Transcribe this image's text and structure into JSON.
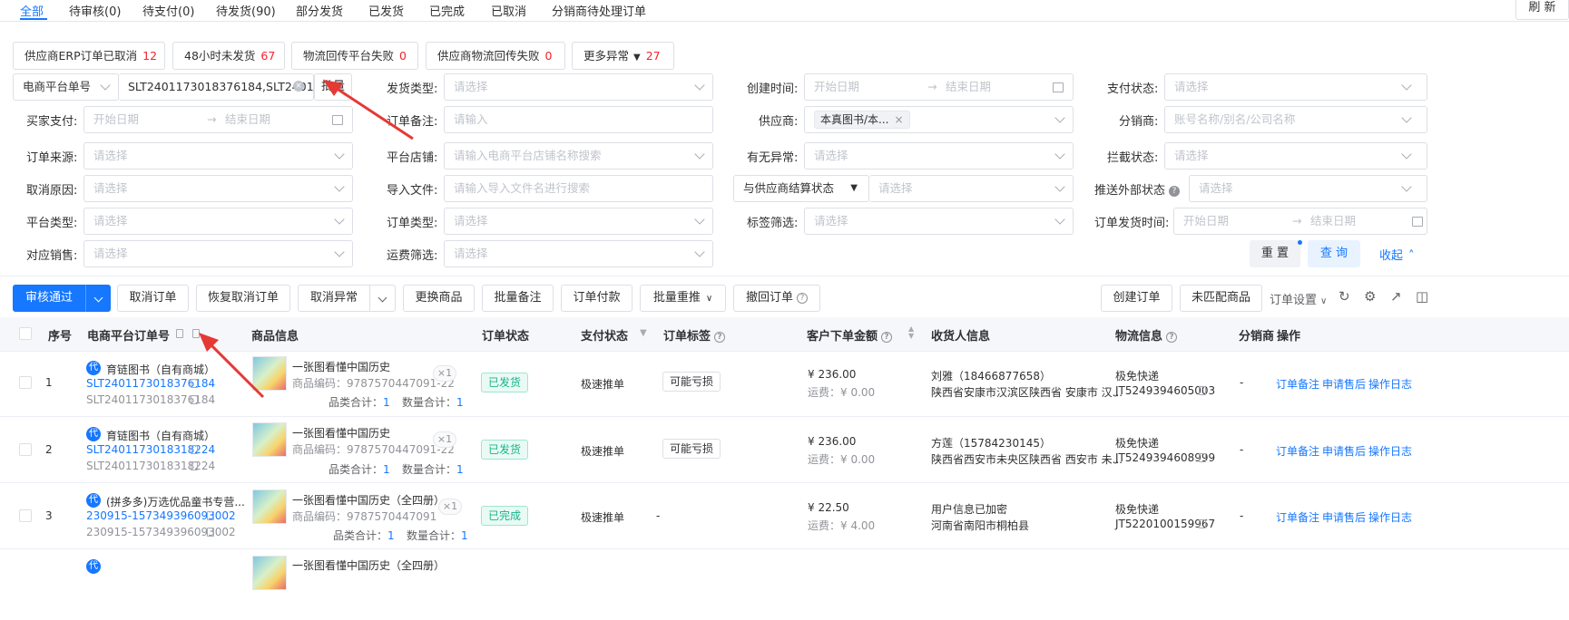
{
  "tabs": [
    "全部",
    "待审核(0)",
    "待支付(0)",
    "待发货(90)",
    "部分发货",
    "已发货",
    "已完成",
    "已取消",
    "分销商待处理订单"
  ],
  "refresh": "刷 新",
  "chips": [
    {
      "label": "供应商ERP订单已取消",
      "count": "12"
    },
    {
      "label": "48小时未发货",
      "count": "67"
    },
    {
      "label": "物流回传平台失败",
      "count": "0"
    },
    {
      "label": "供应商物流回传失败",
      "count": "0"
    },
    {
      "label": "更多异常",
      "count": "27"
    }
  ],
  "filters": {
    "order_no_type": "电商平台单号",
    "order_no_value": "SLT2401173018376184,SLT2401",
    "batch": "批量",
    "ship_type_label": "发货类型:",
    "ship_type_ph": "请选择",
    "created_label": "创建时间:",
    "start_ph": "开始日期",
    "end_ph": "结束日期",
    "pay_status_label": "支付状态:",
    "pay_status_ph": "请选择",
    "buyer_pay_label": "买家支付:",
    "order_remark_label": "订单备注:",
    "order_remark_ph": "请输入",
    "supplier_label": "供应商:",
    "supplier_value": "本真图书/本...",
    "distributor_label": "分销商:",
    "distributor_ph": "账号名称/别名/公司名称",
    "source_label": "订单来源:",
    "source_ph": "请选择",
    "shop_label": "平台店铺:",
    "shop_ph": "请输入电商平台店铺名称搜索",
    "exception_label": "有无异常:",
    "exception_ph": "请选择",
    "intercept_label": "拦截状态:",
    "intercept_ph": "请选择",
    "cancel_label": "取消原因:",
    "cancel_ph": "请选择",
    "import_label": "导入文件:",
    "import_ph": "请输入导入文件名进行搜索",
    "settle_label": "与供应商结算状态",
    "settle_ph": "请选择",
    "push_label": "推送外部状态",
    "push_ph": "请选择",
    "platform_type_label": "平台类型:",
    "platform_type_ph": "请选择",
    "order_type_label": "订单类型:",
    "order_type_ph": "请选择",
    "tag_label": "标签筛选:",
    "tag_ph": "请选择",
    "ship_time_label": "订单发货时间:",
    "sales_label": "对应销售:",
    "sales_ph": "请选择",
    "freight_label": "运费筛选:",
    "freight_ph": "请选择",
    "reset": "重 置",
    "query": "查 询",
    "collapse": "收起"
  },
  "toolbar": {
    "approve": "审核通过",
    "cancel_order": "取消订单",
    "restore_cancel": "恢复取消订单",
    "cancel_exception": "取消异常",
    "replace_goods": "更换商品",
    "batch_remark": "批量备注",
    "order_pay": "订单付款",
    "batch_repush": "批量重推",
    "revoke_order": "撤回订单",
    "create_order": "创建订单",
    "unmatched_goods": "未匹配商品",
    "order_settings": "订单设置"
  },
  "columns": {
    "seq": "序号",
    "order_no": "电商平台订单号",
    "goods": "商品信息",
    "order_status": "订单状态",
    "pay_status": "支付状态",
    "order_tag": "订单标签",
    "amount": "客户下单金额",
    "receiver": "收货人信息",
    "logistics": "物流信息",
    "distributor": "分销商",
    "actions": "操作"
  },
  "rows": [
    {
      "seq": "1",
      "shop": "育链图书（自有商城）",
      "order_no": "SLT2401173018376184",
      "sub_no": "SLT2401173018376184",
      "goods_title": "一张图看懂中国历史",
      "goods_code": "商品编码：9787570447091-22",
      "qty_badge": "×1",
      "cat_total_label": "品类合计：",
      "cat_total": "1",
      "qty_total_label": "数量合计：",
      "qty_total": "1",
      "status": "已发货",
      "pay": "极速推单",
      "tag": "可能亏损",
      "amount": "¥ 236.00",
      "freight": "运费：¥ 0.00",
      "receiver": "刘雅（18466877658）",
      "address": "陕西省安康市汉滨区陕西省 安康市 汉...",
      "carrier": "极免快递",
      "tracking": "JT5249394605003",
      "distributor": "-",
      "act1": "订单备注",
      "act2": "申请售后",
      "act3": "操作日志"
    },
    {
      "seq": "2",
      "shop": "育链图书（自有商城）",
      "order_no": "SLT2401173018318224",
      "sub_no": "SLT2401173018318224",
      "goods_title": "一张图看懂中国历史",
      "goods_code": "商品编码：9787570447091-22",
      "qty_badge": "×1",
      "cat_total_label": "品类合计：",
      "cat_total": "1",
      "qty_total_label": "数量合计：",
      "qty_total": "1",
      "status": "已发货",
      "pay": "极速推单",
      "tag": "可能亏损",
      "amount": "¥ 236.00",
      "freight": "运费：¥ 0.00",
      "receiver": "方莲（15784230145）",
      "address": "陕西省西安市未央区陕西省 西安市 未...",
      "carrier": "极免快递",
      "tracking": "JT5249394608999",
      "distributor": "-",
      "act1": "订单备注",
      "act2": "申请售后",
      "act3": "操作日志"
    },
    {
      "seq": "3",
      "shop": "(拼多多)万选优品童书专营...",
      "order_no": "230915-157349396093002",
      "sub_no": "230915-157349396093002",
      "goods_title": "一张图看懂中国历史（全四册）",
      "goods_code": "商品编码：9787570447091",
      "qty_badge": "×1",
      "cat_total_label": "品类合计：",
      "cat_total": "1",
      "qty_total_label": "数量合计：",
      "qty_total": "1",
      "status": "已完成",
      "pay": "极速推单",
      "tag": "-",
      "amount": "¥ 22.50",
      "freight": "运费：¥ 4.00",
      "receiver": "用户信息已加密",
      "address": "河南省南阳市桐柏县",
      "carrier": "极免快递",
      "tracking": "JT5220100159967",
      "distributor": "-",
      "act1": "订单备注",
      "act2": "申请售后",
      "act3": "操作日志"
    }
  ],
  "row4_goods_title": "一张图看懂中国历史（全四册）",
  "dai": "代",
  "colors": {
    "primary": "#1677ff",
    "danger": "#f5222d",
    "success": "#17b589",
    "annotation": "#e53935"
  }
}
